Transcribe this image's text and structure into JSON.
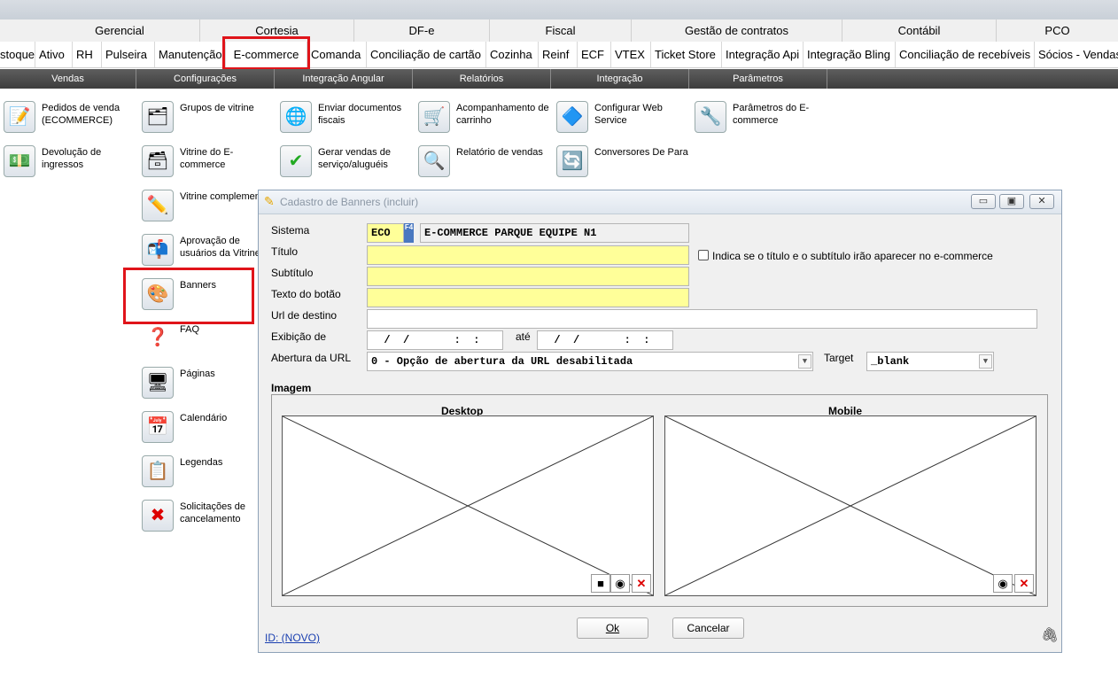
{
  "top_menu": [
    "Gerencial",
    "Cortesia",
    "DF-e",
    "Fiscal",
    "Gestão de contratos",
    "Contábil",
    "PCO"
  ],
  "modules": [
    "stoque",
    "Ativo",
    "RH",
    "Pulseira",
    "Manutenção",
    "E-commerce",
    "Comanda",
    "Conciliação de cartão",
    "Cozinha",
    "Reinf",
    "ECF",
    "VTEX",
    "Ticket Store",
    "Integração Api",
    "Integração Bling",
    "Conciliação de recebíveis",
    "Sócios - Vendas"
  ],
  "sections": [
    "Vendas",
    "Configurações",
    "Integração Angular",
    "Relatórios",
    "Integração",
    "Parâmetros"
  ],
  "menu_items": {
    "pedidos": "Pedidos de venda (ECOMMERCE)",
    "devolucao": "Devolução de ingressos",
    "grupos": "Grupos de vitrine",
    "vitrine": "Vitrine do E-commerce",
    "vitrine_comp": "Vitrine complementar",
    "aprovacao": "Aprovação de usuários da Vitrine",
    "banners": "Banners",
    "faq": "FAQ",
    "paginas": "Páginas",
    "calendario": "Calendário",
    "legendas": "Legendas",
    "solicitacoes": "Solicitações de cancelamento",
    "enviar": "Enviar documentos fiscais",
    "gerar": "Gerar vendas de serviço/aluguéis",
    "acompanhamento": "Acompanhamento de carrinho",
    "relatorio": "Relatório de vendas",
    "configurar": "Configurar Web Service",
    "conversores": "Conversores De Para",
    "parametros": "Parâmetros do E-commerce"
  },
  "dialog": {
    "title": "Cadastro de Banners (incluir)",
    "labels": {
      "sistema": "Sistema",
      "titulo": "Título",
      "subtitulo": "Subtítulo",
      "texto_botao": "Texto do botão",
      "url_destino": "Url de destino",
      "exibicao": "Exibição de",
      "ate": "até",
      "abertura": "Abertura da URL",
      "target": "Target",
      "imagem": "Imagem",
      "desktop": "Desktop",
      "mobile": "Mobile"
    },
    "sistema_code": "ECO",
    "sistema_f4": "F4",
    "sistema_name": "E-COMMERCE PARQUE EQUIPE N1",
    "checkbox_label": "Indica se o título e o subtítulo irão aparecer no e-commerce",
    "date_from": "  /  /       :  :",
    "date_to": "  /  /       :  :",
    "abertura_value": "0 - Opção de abertura da URL desabilitada",
    "target_value": "_blank",
    "ok": "Ok",
    "cancelar": "Cancelar",
    "id_link": "ID: (NOVO)"
  }
}
